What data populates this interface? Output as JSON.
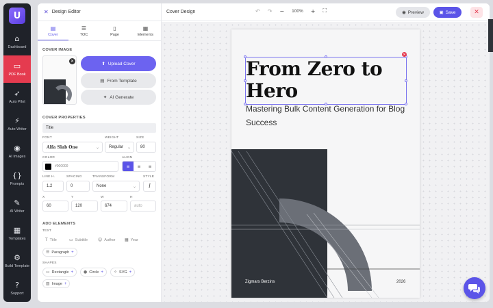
{
  "rail": {
    "logo": "U",
    "items": [
      {
        "label": "Dashboard",
        "icon": "home-icon",
        "glyph": "⌂"
      },
      {
        "label": "PDF Book",
        "icon": "book-icon",
        "glyph": "▭",
        "active": true
      },
      {
        "label": "Auto Pilot",
        "icon": "rocket-icon",
        "glyph": "➶"
      },
      {
        "label": "Auto Writer",
        "icon": "bolt-icon",
        "glyph": "⚡"
      },
      {
        "label": "AI Images",
        "icon": "camera-icon",
        "glyph": "◉"
      },
      {
        "label": "Prompts",
        "icon": "braces-icon",
        "glyph": "{}"
      },
      {
        "label": "AI Writer",
        "icon": "pen-icon",
        "glyph": "✎"
      },
      {
        "label": "Templates",
        "icon": "grid-icon",
        "glyph": "▦"
      },
      {
        "label": "Build Template",
        "icon": "gear-icon",
        "glyph": "⚙"
      },
      {
        "label": "Support",
        "icon": "help-icon",
        "glyph": "?"
      }
    ]
  },
  "header": {
    "editor_title": "Design Editor",
    "doc_title": "Cover Design",
    "zoom": "100%",
    "preview_label": "Preview",
    "save_label": "Save"
  },
  "tabs": [
    {
      "label": "Cover",
      "icon": "cover-icon"
    },
    {
      "label": "TOC",
      "icon": "toc-icon"
    },
    {
      "label": "Page",
      "icon": "page-icon"
    },
    {
      "label": "Elements",
      "icon": "elements-icon"
    }
  ],
  "cover_image": {
    "section_label": "COVER IMAGE",
    "upload_label": "Upload Cover",
    "template_label": "From Template",
    "ai_label": "AI Generate"
  },
  "props": {
    "section_label": "COVER PROPERTIES",
    "element_name": "Title",
    "font_label": "FONT",
    "font_value": "Alfa Slab One",
    "weight_label": "WEIGHT",
    "weight_value": "Regular",
    "size_label": "SIZE",
    "size_value": "80",
    "color_label": "COLOR",
    "color_value": "#000000",
    "align_label": "ALIGN",
    "lineh_label": "LINE H.",
    "lineh_value": "1.2",
    "spacing_label": "SPACING",
    "spacing_value": "0",
    "transform_label": "TRANSFORM",
    "transform_value": "None",
    "style_label": "STYLE",
    "x_label": "X",
    "x_value": "60",
    "y_label": "Y",
    "y_value": "120",
    "w_label": "W",
    "w_value": "674",
    "h_label": "H",
    "h_placeholder": "auto"
  },
  "add_elements": {
    "section_label": "ADD ELEMENTS",
    "text_label": "TEXT",
    "text_items": [
      "Title",
      "Subtitle",
      "Author",
      "Year"
    ],
    "paragraph": "Paragraph",
    "shapes_label": "SHAPES",
    "shapes": [
      "Rectangle",
      "Circle",
      "SVG"
    ],
    "image": "Image"
  },
  "cover": {
    "title": "From Zero to Hero",
    "subtitle": "Mastering Bulk Content Generation for Blog Success",
    "author": "Zigmars Berzins",
    "year": "2026"
  },
  "colors": {
    "accent": "#5b54e8",
    "rail_bg": "#1f2229",
    "rail_active": "#e53b4f",
    "cover_dark": "#2f3339"
  }
}
